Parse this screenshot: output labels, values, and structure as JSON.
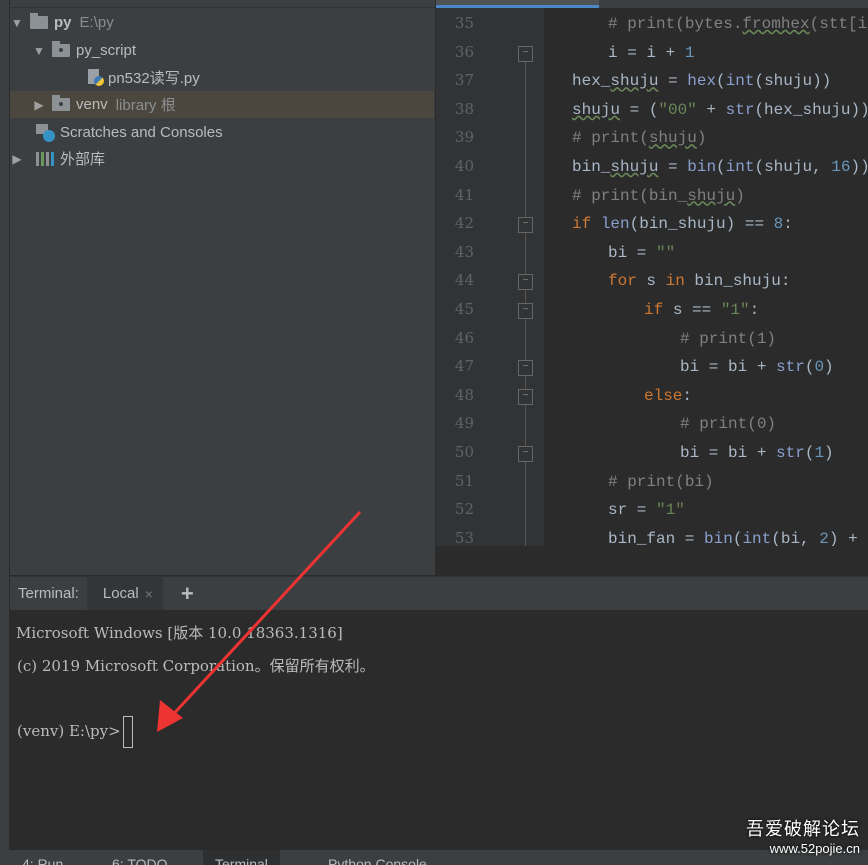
{
  "project": {
    "root": {
      "name": "py",
      "path": "E:\\py"
    },
    "folder": "py_script",
    "file": "pn532读写.py",
    "venv": {
      "name": "venv",
      "note": "library 根"
    },
    "scratches": "Scratches and Consoles",
    "external": "外部库"
  },
  "editor": {
    "lines": [
      {
        "n": "35",
        "indent": 1,
        "tokens": [
          [
            "# print(bytes.",
            "cm"
          ],
          [
            "fromhex",
            "cm sq"
          ],
          [
            "(stt[i])",
            "cm"
          ]
        ]
      },
      {
        "n": "36",
        "indent": 1,
        "fold": "end",
        "tokens": [
          [
            "i = i + ",
            ""
          ],
          [
            "1",
            "nm"
          ]
        ]
      },
      {
        "n": "37",
        "indent": 0,
        "tokens": [
          [
            "hex_",
            ""
          ],
          [
            "shuju",
            "sq"
          ],
          [
            " = ",
            ""
          ],
          [
            "hex",
            "bi"
          ],
          [
            "(",
            ""
          ],
          [
            "int",
            "bi"
          ],
          [
            "(shuju))",
            ""
          ]
        ]
      },
      {
        "n": "38",
        "indent": 0,
        "tokens": [
          [
            "shuju",
            "sq"
          ],
          [
            " = (",
            ""
          ],
          [
            "\"00\"",
            "st"
          ],
          [
            " + ",
            ""
          ],
          [
            "str",
            "bi"
          ],
          [
            "(hex_shuju))[-",
            ""
          ]
        ]
      },
      {
        "n": "39",
        "indent": 0,
        "tokens": [
          [
            "# print(",
            "cm"
          ],
          [
            "shuju",
            "cm sq"
          ],
          [
            ")",
            "cm"
          ]
        ]
      },
      {
        "n": "40",
        "indent": 0,
        "tokens": [
          [
            "bin_",
            ""
          ],
          [
            "shuju",
            "sq"
          ],
          [
            " = ",
            ""
          ],
          [
            "bin",
            "bi"
          ],
          [
            "(",
            ""
          ],
          [
            "int",
            "bi"
          ],
          [
            "(shuju, ",
            ""
          ],
          [
            "16",
            "nm"
          ],
          [
            ")).l",
            ""
          ]
        ]
      },
      {
        "n": "41",
        "indent": 0,
        "tokens": [
          [
            "# print(bin_",
            "cm"
          ],
          [
            "shuju",
            "cm sq"
          ],
          [
            ")",
            "cm"
          ]
        ]
      },
      {
        "n": "42",
        "indent": 0,
        "fold": "start",
        "tokens": [
          [
            "if ",
            "kw"
          ],
          [
            "len",
            "bi"
          ],
          [
            "(bin_shuju) == ",
            ""
          ],
          [
            "8",
            "nm"
          ],
          [
            ":",
            ""
          ]
        ]
      },
      {
        "n": "43",
        "indent": 1,
        "tokens": [
          [
            "bi = ",
            ""
          ],
          [
            "\"\"",
            "st"
          ]
        ]
      },
      {
        "n": "44",
        "indent": 1,
        "fold": "start",
        "tokens": [
          [
            "for ",
            "kw"
          ],
          [
            "s ",
            ""
          ],
          [
            "in ",
            "kw"
          ],
          [
            "bin_shuju:",
            ""
          ]
        ]
      },
      {
        "n": "45",
        "indent": 2,
        "fold": "start",
        "tokens": [
          [
            "if ",
            "kw"
          ],
          [
            "s == ",
            ""
          ],
          [
            "\"1\"",
            "st"
          ],
          [
            ":",
            ""
          ]
        ]
      },
      {
        "n": "46",
        "indent": 3,
        "tokens": [
          [
            "# print(1)",
            "cm"
          ]
        ]
      },
      {
        "n": "47",
        "indent": 3,
        "fold": "end",
        "tokens": [
          [
            "bi = bi + ",
            ""
          ],
          [
            "str",
            "bi"
          ],
          [
            "(",
            ""
          ],
          [
            "0",
            "nm"
          ],
          [
            ")",
            ""
          ]
        ]
      },
      {
        "n": "48",
        "indent": 2,
        "fold": "start",
        "tokens": [
          [
            "else",
            "kw"
          ],
          [
            ":",
            ""
          ]
        ]
      },
      {
        "n": "49",
        "indent": 3,
        "tokens": [
          [
            "# print(0)",
            "cm"
          ]
        ]
      },
      {
        "n": "50",
        "indent": 3,
        "fold": "end",
        "tokens": [
          [
            "bi = bi + ",
            ""
          ],
          [
            "str",
            "bi"
          ],
          [
            "(",
            ""
          ],
          [
            "1",
            "nm"
          ],
          [
            ")",
            ""
          ]
        ]
      },
      {
        "n": "51",
        "indent": 1,
        "tokens": [
          [
            "# print(bi)",
            "cm"
          ]
        ]
      },
      {
        "n": "52",
        "indent": 1,
        "tokens": [
          [
            "sr = ",
            ""
          ],
          [
            "\"1\"",
            "st"
          ]
        ]
      },
      {
        "n": "53",
        "indent": 1,
        "tokens": [
          [
            "bin_fan = ",
            ""
          ],
          [
            "bin",
            "bi"
          ],
          [
            "(",
            ""
          ],
          [
            "int",
            "bi"
          ],
          [
            "(bi, ",
            ""
          ],
          [
            "2",
            "nm"
          ],
          [
            ") + in",
            ""
          ]
        ]
      }
    ]
  },
  "terminal": {
    "label": "Terminal:",
    "tab": "Local",
    "close": "×",
    "add": "+",
    "lines": [
      "Microsoft Windows [版本 10.0.18363.1316]",
      "(c) 2019 Microsoft Corporation。保留所有权利。"
    ],
    "prompt": "(venv) E:\\py>"
  },
  "bottom_tabs": [
    "4: Run",
    "6: TODO",
    "Terminal",
    "Python Console"
  ],
  "watermark": {
    "title": "吾爱破解论坛",
    "url": "www.52pojie.cn"
  },
  "colors": {
    "annotation_arrow": "#ee3333"
  }
}
